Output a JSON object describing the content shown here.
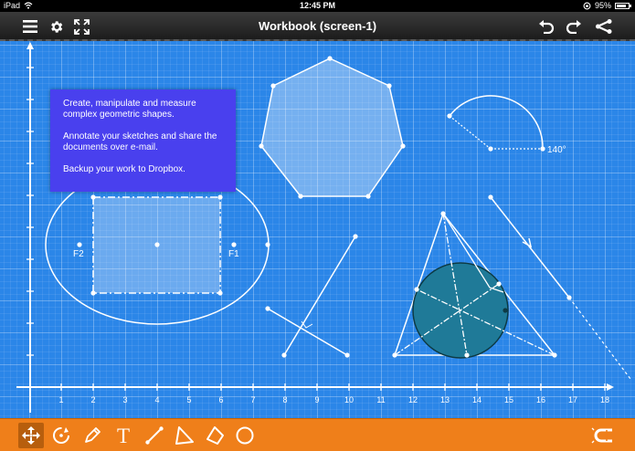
{
  "status_bar": {
    "device": "iPad",
    "time": "12:45 PM",
    "battery": "95%"
  },
  "toolbar": {
    "title": "Workbook (screen-1)",
    "left_icons": [
      "menu-icon",
      "gear-icon",
      "fullscreen-icon"
    ],
    "right_icons": [
      "undo-icon",
      "redo-icon",
      "share-icon"
    ]
  },
  "info_box": {
    "line1": "Create, manipulate and measure complex geometric shapes.",
    "line2": "Annotate your sketches and share the documents over e-mail.",
    "line3": "Backup your work to Dropbox."
  },
  "canvas": {
    "x_axis_labels": [
      "1",
      "2",
      "3",
      "4",
      "5",
      "6",
      "7",
      "8",
      "9",
      "10",
      "11",
      "12",
      "13",
      "14",
      "15",
      "16",
      "17",
      "18"
    ],
    "labels": {
      "focus_left": "F2",
      "focus_right": "F1",
      "arc_angle": "140°"
    },
    "colors": {
      "background": "#2b86e8",
      "circle_fill": "#1f7a98"
    }
  },
  "bottom_toolbar": {
    "tools": [
      "move-icon",
      "rotate-icon",
      "pencil-icon",
      "text-tool-icon",
      "line-tool-icon",
      "triangle-tool-icon",
      "quad-tool-icon",
      "circle-tool-icon"
    ],
    "text_tool_glyph": "T",
    "active_tool": "move-icon",
    "right_icon": "magnet-icon",
    "accent": "#ef7f1a"
  }
}
